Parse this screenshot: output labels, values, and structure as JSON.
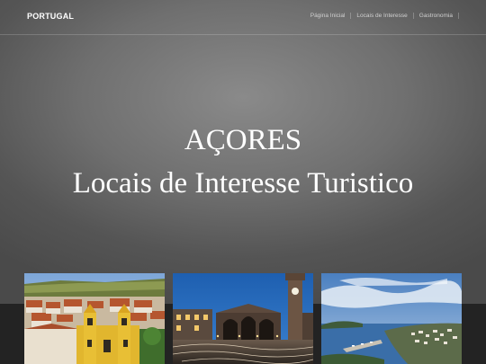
{
  "navbar": {
    "brand": "PORTUGAL",
    "links": [
      "Página Inicial",
      "Locais de Interesse",
      "Gastronomia"
    ]
  },
  "hero": {
    "title": "AÇORES",
    "subtitle": "Locais de Interesse Turistico"
  },
  "colors": {
    "hero_center": "#8a8a8a",
    "hero_edge": "#4a4a4a",
    "footer_band": "#232323",
    "text": "#ffffff"
  },
  "gallery": {
    "images": [
      "town-with-church-photo",
      "city-gates-at-night-photo",
      "coastal-bay-photo"
    ]
  }
}
